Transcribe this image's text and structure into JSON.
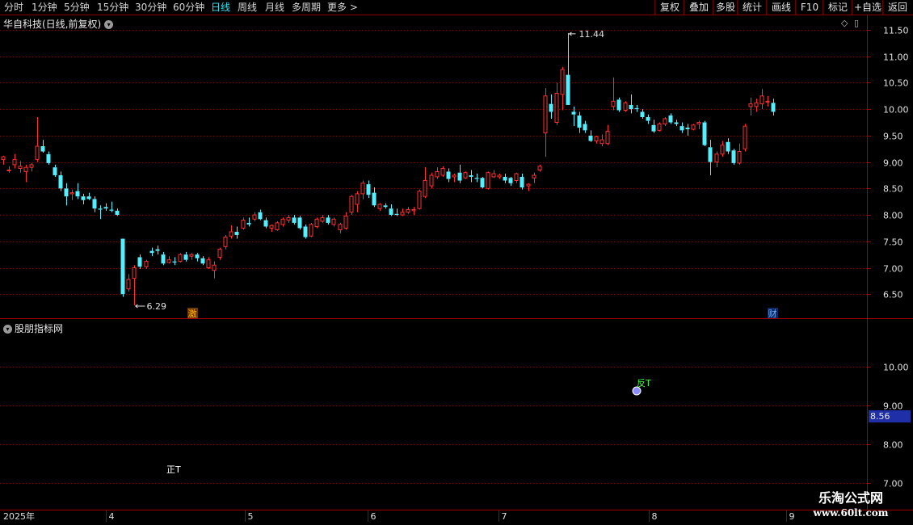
{
  "toolbar": {
    "periods": [
      "分时",
      "1分钟",
      "5分钟",
      "15分钟",
      "30分钟",
      "60分钟",
      "日线",
      "周线",
      "月线",
      "多周期",
      "更多 >"
    ],
    "active_period": "日线",
    "right_buttons": [
      "复权",
      "叠加",
      "多股",
      "统计",
      "画线",
      "F10",
      "标记",
      "+自选",
      "返回"
    ]
  },
  "main_panel": {
    "title": "华自科技(日线,前复权)",
    "price_axis": [
      "11.50",
      "11.00",
      "10.50",
      "10.00",
      "9.50",
      "9.00",
      "8.50",
      "8.00",
      "7.50",
      "7.00",
      "6.50"
    ],
    "high_marker": "11.44",
    "low_marker": "6.29",
    "event_badges": [
      "激",
      "财"
    ]
  },
  "sub_panel": {
    "title": "股朋指标网",
    "price_axis": [
      "10.00",
      "9.00",
      "8.00",
      "7.00"
    ],
    "current_value": "8.56",
    "signals": [
      "正T",
      "反T"
    ]
  },
  "time_axis": [
    "2025年",
    "4",
    "5",
    "6",
    "7",
    "8",
    "9"
  ],
  "watermark": {
    "line1": "乐淘公式网",
    "line2": "www.60lt.com"
  },
  "colors": {
    "up": "#ff3030",
    "down": "#54f0ff",
    "grid": "#8b0000",
    "active_tab": "#33e6f5"
  },
  "chart_data": {
    "type": "candlestick",
    "title": "华自科技(日线,前复权)",
    "ylim": [
      6.2,
      11.7
    ],
    "high": 11.44,
    "low": 6.29,
    "candles": [
      [
        9.05,
        9.12,
        8.95,
        9.1
      ],
      [
        8.85,
        8.92,
        8.8,
        8.85
      ],
      [
        8.95,
        9.15,
        8.88,
        9.05
      ],
      [
        8.88,
        9.02,
        8.8,
        8.92
      ],
      [
        8.82,
        8.95,
        8.62,
        8.9
      ],
      [
        8.9,
        8.98,
        8.82,
        8.95
      ],
      [
        9.05,
        9.85,
        9.0,
        9.3
      ],
      [
        9.3,
        9.42,
        9.18,
        9.2
      ],
      [
        9.15,
        9.2,
        8.95,
        8.98
      ],
      [
        8.9,
        8.95,
        8.72,
        8.75
      ],
      [
        8.75,
        8.82,
        8.45,
        8.5
      ],
      [
        8.5,
        8.6,
        8.18,
        8.35
      ],
      [
        8.4,
        8.48,
        8.28,
        8.42
      ],
      [
        8.45,
        8.6,
        8.3,
        8.35
      ],
      [
        8.35,
        8.4,
        8.2,
        8.28
      ],
      [
        8.35,
        8.42,
        8.28,
        8.3
      ],
      [
        8.3,
        8.35,
        8.05,
        8.12
      ],
      [
        8.12,
        8.18,
        7.92,
        8.1
      ],
      [
        8.15,
        8.22,
        8.08,
        8.12
      ],
      [
        8.1,
        8.25,
        8.05,
        8.08
      ],
      [
        8.08,
        8.12,
        7.98,
        8.0
      ],
      [
        7.55,
        7.55,
        6.45,
        6.5
      ],
      [
        6.6,
        6.88,
        6.55,
        6.78
      ],
      [
        6.8,
        7.05,
        6.29,
        7.0
      ],
      [
        7.2,
        7.25,
        6.98,
        7.02
      ],
      [
        7.02,
        7.15,
        6.98,
        7.12
      ],
      [
        7.32,
        7.38,
        7.22,
        7.28
      ],
      [
        7.35,
        7.42,
        7.25,
        7.32
      ],
      [
        7.25,
        7.3,
        7.05,
        7.08
      ],
      [
        7.1,
        7.22,
        7.08,
        7.15
      ],
      [
        7.12,
        7.2,
        7.05,
        7.1
      ],
      [
        7.12,
        7.28,
        7.1,
        7.25
      ],
      [
        7.25,
        7.3,
        7.12,
        7.15
      ],
      [
        7.22,
        7.28,
        7.15,
        7.25
      ],
      [
        7.25,
        7.28,
        7.12,
        7.18
      ],
      [
        7.18,
        7.22,
        7.05,
        7.08
      ],
      [
        7.0,
        7.2,
        6.98,
        7.15
      ],
      [
        6.95,
        7.12,
        6.8,
        7.05
      ],
      [
        7.2,
        7.38,
        7.15,
        7.35
      ],
      [
        7.4,
        7.62,
        7.35,
        7.58
      ],
      [
        7.6,
        7.8,
        7.55,
        7.68
      ],
      [
        7.68,
        7.78,
        7.55,
        7.62
      ],
      [
        7.75,
        7.95,
        7.72,
        7.9
      ],
      [
        7.85,
        7.95,
        7.78,
        7.82
      ],
      [
        7.92,
        8.05,
        7.88,
        8.0
      ],
      [
        8.05,
        8.1,
        7.9,
        7.92
      ],
      [
        7.9,
        7.95,
        7.75,
        7.78
      ],
      [
        7.75,
        7.82,
        7.68,
        7.8
      ],
      [
        7.72,
        7.88,
        7.7,
        7.85
      ],
      [
        7.82,
        7.95,
        7.78,
        7.92
      ],
      [
        7.9,
        8.0,
        7.85,
        7.95
      ],
      [
        7.95,
        8.0,
        7.82,
        7.85
      ],
      [
        7.95,
        7.98,
        7.72,
        7.75
      ],
      [
        7.78,
        7.82,
        7.55,
        7.58
      ],
      [
        7.6,
        7.85,
        7.58,
        7.82
      ],
      [
        7.78,
        7.95,
        7.75,
        7.92
      ],
      [
        7.88,
        8.0,
        7.85,
        7.95
      ],
      [
        7.95,
        8.0,
        7.82,
        7.85
      ],
      [
        7.82,
        7.95,
        7.78,
        7.92
      ],
      [
        7.72,
        7.85,
        7.65,
        7.82
      ],
      [
        7.75,
        8.05,
        7.72,
        7.98
      ],
      [
        8.05,
        8.38,
        8.0,
        8.35
      ],
      [
        8.2,
        8.45,
        8.05,
        8.4
      ],
      [
        8.4,
        8.65,
        8.3,
        8.6
      ],
      [
        8.58,
        8.65,
        8.32,
        8.38
      ],
      [
        8.42,
        8.52,
        8.15,
        8.18
      ],
      [
        8.12,
        8.22,
        8.08,
        8.2
      ],
      [
        8.18,
        8.22,
        8.12,
        8.15
      ],
      [
        8.12,
        8.2,
        7.98,
        8.0
      ],
      [
        8.02,
        8.12,
        7.98,
        8.0
      ],
      [
        8.0,
        8.12,
        7.98,
        8.05
      ],
      [
        8.05,
        8.15,
        8.02,
        8.1
      ],
      [
        8.08,
        8.15,
        8.0,
        8.1
      ],
      [
        8.12,
        8.48,
        8.1,
        8.45
      ],
      [
        8.35,
        8.9,
        8.32,
        8.65
      ],
      [
        8.55,
        8.8,
        8.5,
        8.75
      ],
      [
        8.72,
        8.9,
        8.68,
        8.82
      ],
      [
        8.75,
        8.92,
        8.72,
        8.88
      ],
      [
        8.82,
        8.88,
        8.62,
        8.68
      ],
      [
        8.72,
        8.78,
        8.62,
        8.75
      ],
      [
        8.8,
        8.95,
        8.6,
        8.65
      ],
      [
        8.7,
        8.82,
        8.68,
        8.8
      ],
      [
        8.75,
        8.85,
        8.62,
        8.72
      ],
      [
        8.7,
        8.78,
        8.62,
        8.68
      ],
      [
        8.7,
        8.72,
        8.5,
        8.52
      ],
      [
        8.5,
        8.82,
        8.48,
        8.8
      ],
      [
        8.72,
        8.85,
        8.7,
        8.78
      ],
      [
        8.72,
        8.78,
        8.68,
        8.75
      ],
      [
        8.72,
        8.78,
        8.6,
        8.65
      ],
      [
        8.7,
        8.72,
        8.55,
        8.6
      ],
      [
        8.65,
        8.8,
        8.6,
        8.78
      ],
      [
        8.72,
        8.78,
        8.48,
        8.52
      ],
      [
        8.55,
        8.6,
        8.45,
        8.58
      ],
      [
        8.7,
        8.8,
        8.6,
        8.75
      ],
      [
        8.85,
        8.95,
        8.82,
        8.92
      ],
      [
        9.55,
        10.4,
        9.1,
        10.25
      ],
      [
        10.1,
        10.28,
        9.82,
        9.95
      ],
      [
        9.75,
        10.5,
        9.7,
        10.3
      ],
      [
        10.28,
        10.8,
        9.98,
        10.75
      ],
      [
        10.65,
        11.44,
        10.25,
        10.08
      ],
      [
        9.95,
        10.05,
        9.68,
        9.9
      ],
      [
        9.88,
        9.95,
        9.55,
        9.65
      ],
      [
        9.72,
        9.78,
        9.55,
        9.6
      ],
      [
        9.5,
        9.6,
        9.38,
        9.4
      ],
      [
        9.4,
        9.5,
        9.35,
        9.48
      ],
      [
        9.35,
        9.52,
        9.3,
        9.42
      ],
      [
        9.35,
        9.7,
        9.32,
        9.58
      ],
      [
        10.05,
        10.6,
        9.98,
        10.15
      ],
      [
        10.18,
        10.22,
        9.95,
        9.98
      ],
      [
        9.98,
        10.15,
        9.95,
        10.12
      ],
      [
        10.08,
        10.28,
        9.92,
        10.0
      ],
      [
        10.02,
        10.08,
        9.95,
        10.0
      ],
      [
        9.95,
        10.0,
        9.82,
        9.85
      ],
      [
        9.85,
        9.9,
        9.72,
        9.78
      ],
      [
        9.7,
        9.8,
        9.55,
        9.58
      ],
      [
        9.6,
        9.75,
        9.58,
        9.72
      ],
      [
        9.72,
        9.85,
        9.68,
        9.82
      ],
      [
        9.88,
        9.92,
        9.72,
        9.75
      ],
      [
        9.75,
        9.8,
        9.68,
        9.72
      ],
      [
        9.68,
        9.75,
        9.55,
        9.6
      ],
      [
        9.65,
        9.72,
        9.5,
        9.62
      ],
      [
        9.62,
        9.72,
        9.6,
        9.7
      ],
      [
        9.72,
        9.78,
        9.62,
        9.75
      ],
      [
        9.75,
        9.78,
        9.3,
        9.32
      ],
      [
        9.28,
        9.42,
        8.75,
        9.0
      ],
      [
        9.0,
        9.2,
        8.9,
        9.15
      ],
      [
        9.15,
        9.4,
        9.1,
        9.32
      ],
      [
        9.38,
        9.45,
        9.15,
        9.2
      ],
      [
        9.22,
        9.25,
        8.95,
        8.98
      ],
      [
        8.98,
        9.35,
        8.95,
        9.2
      ],
      [
        9.25,
        9.72,
        9.2,
        9.68
      ],
      [
        10.05,
        10.22,
        9.88,
        10.1
      ],
      [
        10.05,
        10.2,
        9.95,
        10.12
      ],
      [
        10.1,
        10.38,
        10.0,
        10.25
      ],
      [
        10.15,
        10.25,
        10.05,
        10.15
      ],
      [
        10.12,
        10.2,
        9.88,
        9.95
      ]
    ],
    "x_ticks": [
      "2025年",
      "4",
      "5",
      "6",
      "7",
      "8",
      "9"
    ],
    "sub_indicator": {
      "name": "股朋指标网",
      "ylim": [
        6.95,
        11.0
      ],
      "current_value": 8.56,
      "signals": [
        {
          "label": "正T",
          "value": 7.35
        },
        {
          "label": "反T",
          "value": 9.5
        }
      ]
    }
  }
}
